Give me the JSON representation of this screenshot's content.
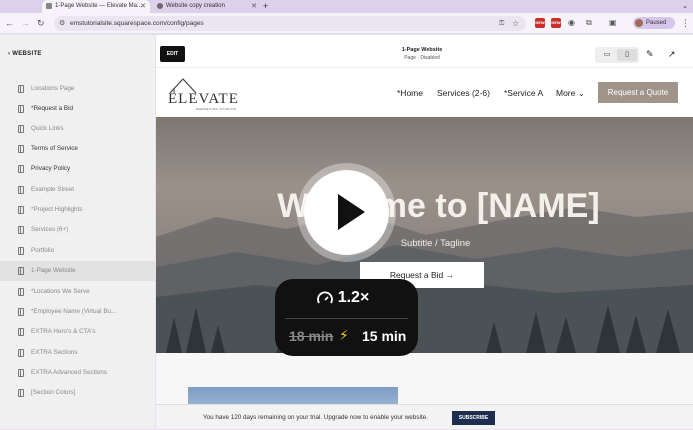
{
  "browser": {
    "tabs": [
      {
        "title": "1-Page Website — Elevate Ma..."
      },
      {
        "title": "Website copy creation"
      }
    ],
    "new_tab": "+",
    "url": "emstutorialsite.squarespace.com/config/pages",
    "profile_status": "Paused",
    "ext_badges": [
      "NEW",
      "NEW"
    ]
  },
  "sidebar": {
    "back_label": "WEBSITE",
    "items": [
      {
        "label": "Locations Page"
      },
      {
        "label": "*Request a Bid"
      },
      {
        "label": "Quick Links"
      },
      {
        "label": "Terms of Service"
      },
      {
        "label": "Privacy Policy"
      },
      {
        "label": "Example Street"
      },
      {
        "label": "*Project Highlights"
      },
      {
        "label": "Services (6+)"
      },
      {
        "label": "Portfolio"
      },
      {
        "label": "1-Page Website"
      },
      {
        "label": "*Locations We Serve"
      },
      {
        "label": "*Employee Name (Virtual Bu..."
      },
      {
        "label": "EXTRA Hero's & CTA's"
      },
      {
        "label": "EXTRA Sections"
      },
      {
        "label": "EXTRA Advanced Sections"
      },
      {
        "label": "[Section Colors]"
      }
    ]
  },
  "editor": {
    "edit_label": "EDIT",
    "page_title": "1-Page Website",
    "page_status": "Page · Disabled"
  },
  "site": {
    "logo_name": "ELEVATE",
    "logo_sub": "MARKETING STUDIOS",
    "nav": [
      "*Home",
      "Services (2-6)",
      "*Service A",
      "More"
    ],
    "quote_btn": "Request a Quote",
    "hero_title": "Welcome to [NAME]",
    "hero_sub": "Subtitle / Tagline",
    "hero_btn": "Request a Bid →"
  },
  "trial": {
    "text": "You have 120 days remaining on your trial. Upgrade now to enable your website.",
    "subscribe": "SUBSCRIBE"
  },
  "overlay": {
    "rate": "1.2×",
    "old_time": "18 min",
    "new_time": "15 min"
  }
}
